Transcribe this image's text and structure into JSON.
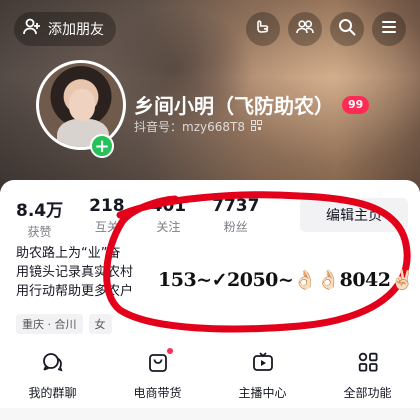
{
  "header": {
    "add_friend_label": "添加朋友",
    "icons": [
      "add-user-icon",
      "hand-icon",
      "friends-icon",
      "search-icon",
      "menu-icon"
    ]
  },
  "profile": {
    "name": "乡间小明（飞防助农）",
    "level": "99",
    "douyin_id": "抖音号：mzy668T8"
  },
  "stats": [
    {
      "value": "8.4万",
      "label": "获赞"
    },
    {
      "value": "218",
      "label": "互关"
    },
    {
      "value": "401",
      "label": "关注"
    },
    {
      "value": "7737",
      "label": "粉丝"
    }
  ],
  "edit_button": "编辑主页",
  "bio": [
    "助农路上为“业”奋",
    "用镜头记录真实农村",
    "用行动帮助更多农户"
  ],
  "tags": [
    "重庆 · 合川",
    "女"
  ],
  "overlay_text": "153~✓2050~👌🏻👌🏻8042✌🏻",
  "shortcuts": [
    {
      "label": "我的群聊",
      "icon": "chat-icon"
    },
    {
      "label": "电商带货",
      "icon": "shopping-bag-icon"
    },
    {
      "label": "主播中心",
      "icon": "live-icon"
    },
    {
      "label": "全部功能",
      "icon": "apps-icon"
    }
  ],
  "colors": {
    "accent": "#fe2c55",
    "online": "#25c25a",
    "scribble": "#e3001b"
  }
}
